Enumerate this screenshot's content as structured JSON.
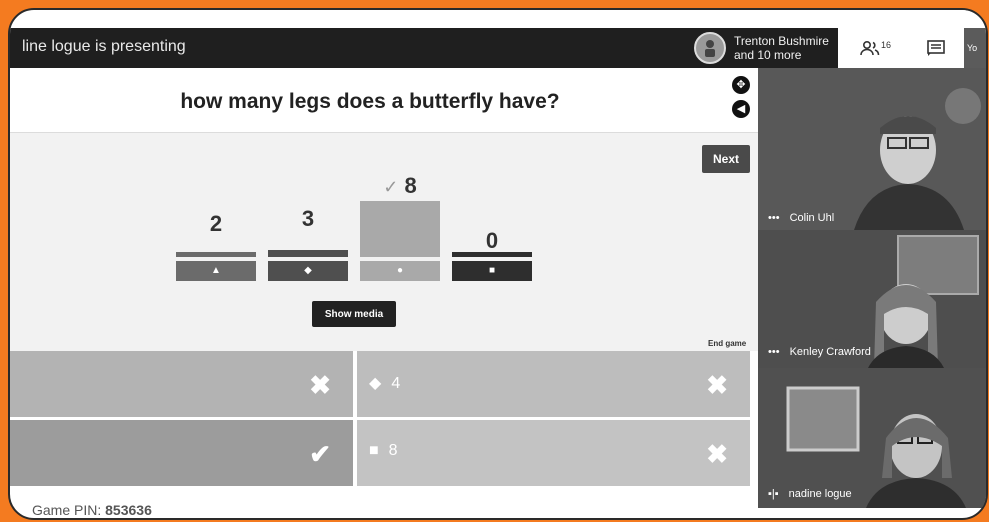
{
  "topbar": {
    "presenting_text": "line logue is presenting",
    "presenter_line1": "Trenton Bushmire",
    "presenter_line2": "and 10 more",
    "people_count": "16",
    "you_label": "Yo"
  },
  "quiz": {
    "question": "how many legs does a butterfly have?",
    "next_label": "Next",
    "show_media_label": "Show media",
    "end_game_label": "End game",
    "correct_check": "✓",
    "bars": [
      {
        "value": "2",
        "shape": "▲",
        "color": "#6b6b6b",
        "correct": false
      },
      {
        "value": "3",
        "shape": "◆",
        "color": "#4f4f4f",
        "correct": false
      },
      {
        "value": "8",
        "shape": "●",
        "color": "#a9a9a9",
        "correct": true
      },
      {
        "value": "0",
        "shape": "■",
        "color": "#2e2e2e",
        "correct": false
      }
    ],
    "answers": [
      {
        "shape": "",
        "text": "",
        "mark": "✖",
        "color": "#b3b3b3"
      },
      {
        "shape": "◆",
        "text": "4",
        "mark": "✖",
        "color": "#bdbdbd"
      },
      {
        "shape": "",
        "text": "",
        "mark": "✔",
        "color": "#9c9c9c"
      },
      {
        "shape": "■",
        "text": "8",
        "mark": "✖",
        "color": "#c3c3c3"
      }
    ],
    "game_pin_label": "Game PIN:",
    "game_pin_value": "853636"
  },
  "participants": [
    {
      "name": "Colin Uhl",
      "icon": "more-dots"
    },
    {
      "name": "Kenley Crawford",
      "icon": "more-dots"
    },
    {
      "name": "nadine logue",
      "icon": "audio-level"
    }
  ]
}
